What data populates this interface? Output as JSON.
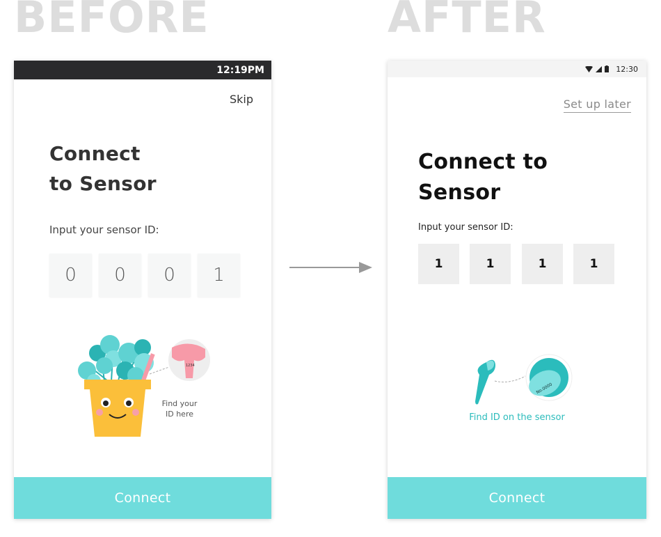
{
  "headings": {
    "before": "BEFORE",
    "after": "AFTER"
  },
  "before": {
    "status_time": "12:19PM",
    "skip_label": "Skip",
    "title_line1": "Connect",
    "title_line2": "to Sensor",
    "input_label": "Input your sensor ID:",
    "digits": [
      "0",
      "0",
      "0",
      "1"
    ],
    "sensor_tag_text": "1234",
    "find_text_line1": "Find your",
    "find_text_line2": "ID here",
    "connect_label": "Connect"
  },
  "after": {
    "status_time": "12:30",
    "setup_later_label": "Set up later",
    "title_line1": "Connect to",
    "title_line2": "Sensor",
    "input_label": "Input your sensor ID:",
    "digits": [
      "1",
      "1",
      "1",
      "1"
    ],
    "sensor_tag_text": "No.0000",
    "find_text": "Find ID on the sensor",
    "connect_label": "Connect"
  },
  "colors": {
    "accent": "#6fdcdc",
    "teal": "#2bbcbc",
    "pot": "#fbbf3a",
    "tag_pink": "#f79aa8",
    "heading_gray": "#dddddd"
  },
  "icons": [
    "wifi-icon",
    "signal-icon",
    "battery-icon",
    "arrow-right-icon",
    "plant-pot-illustration",
    "sensor-tag-illustration"
  ]
}
